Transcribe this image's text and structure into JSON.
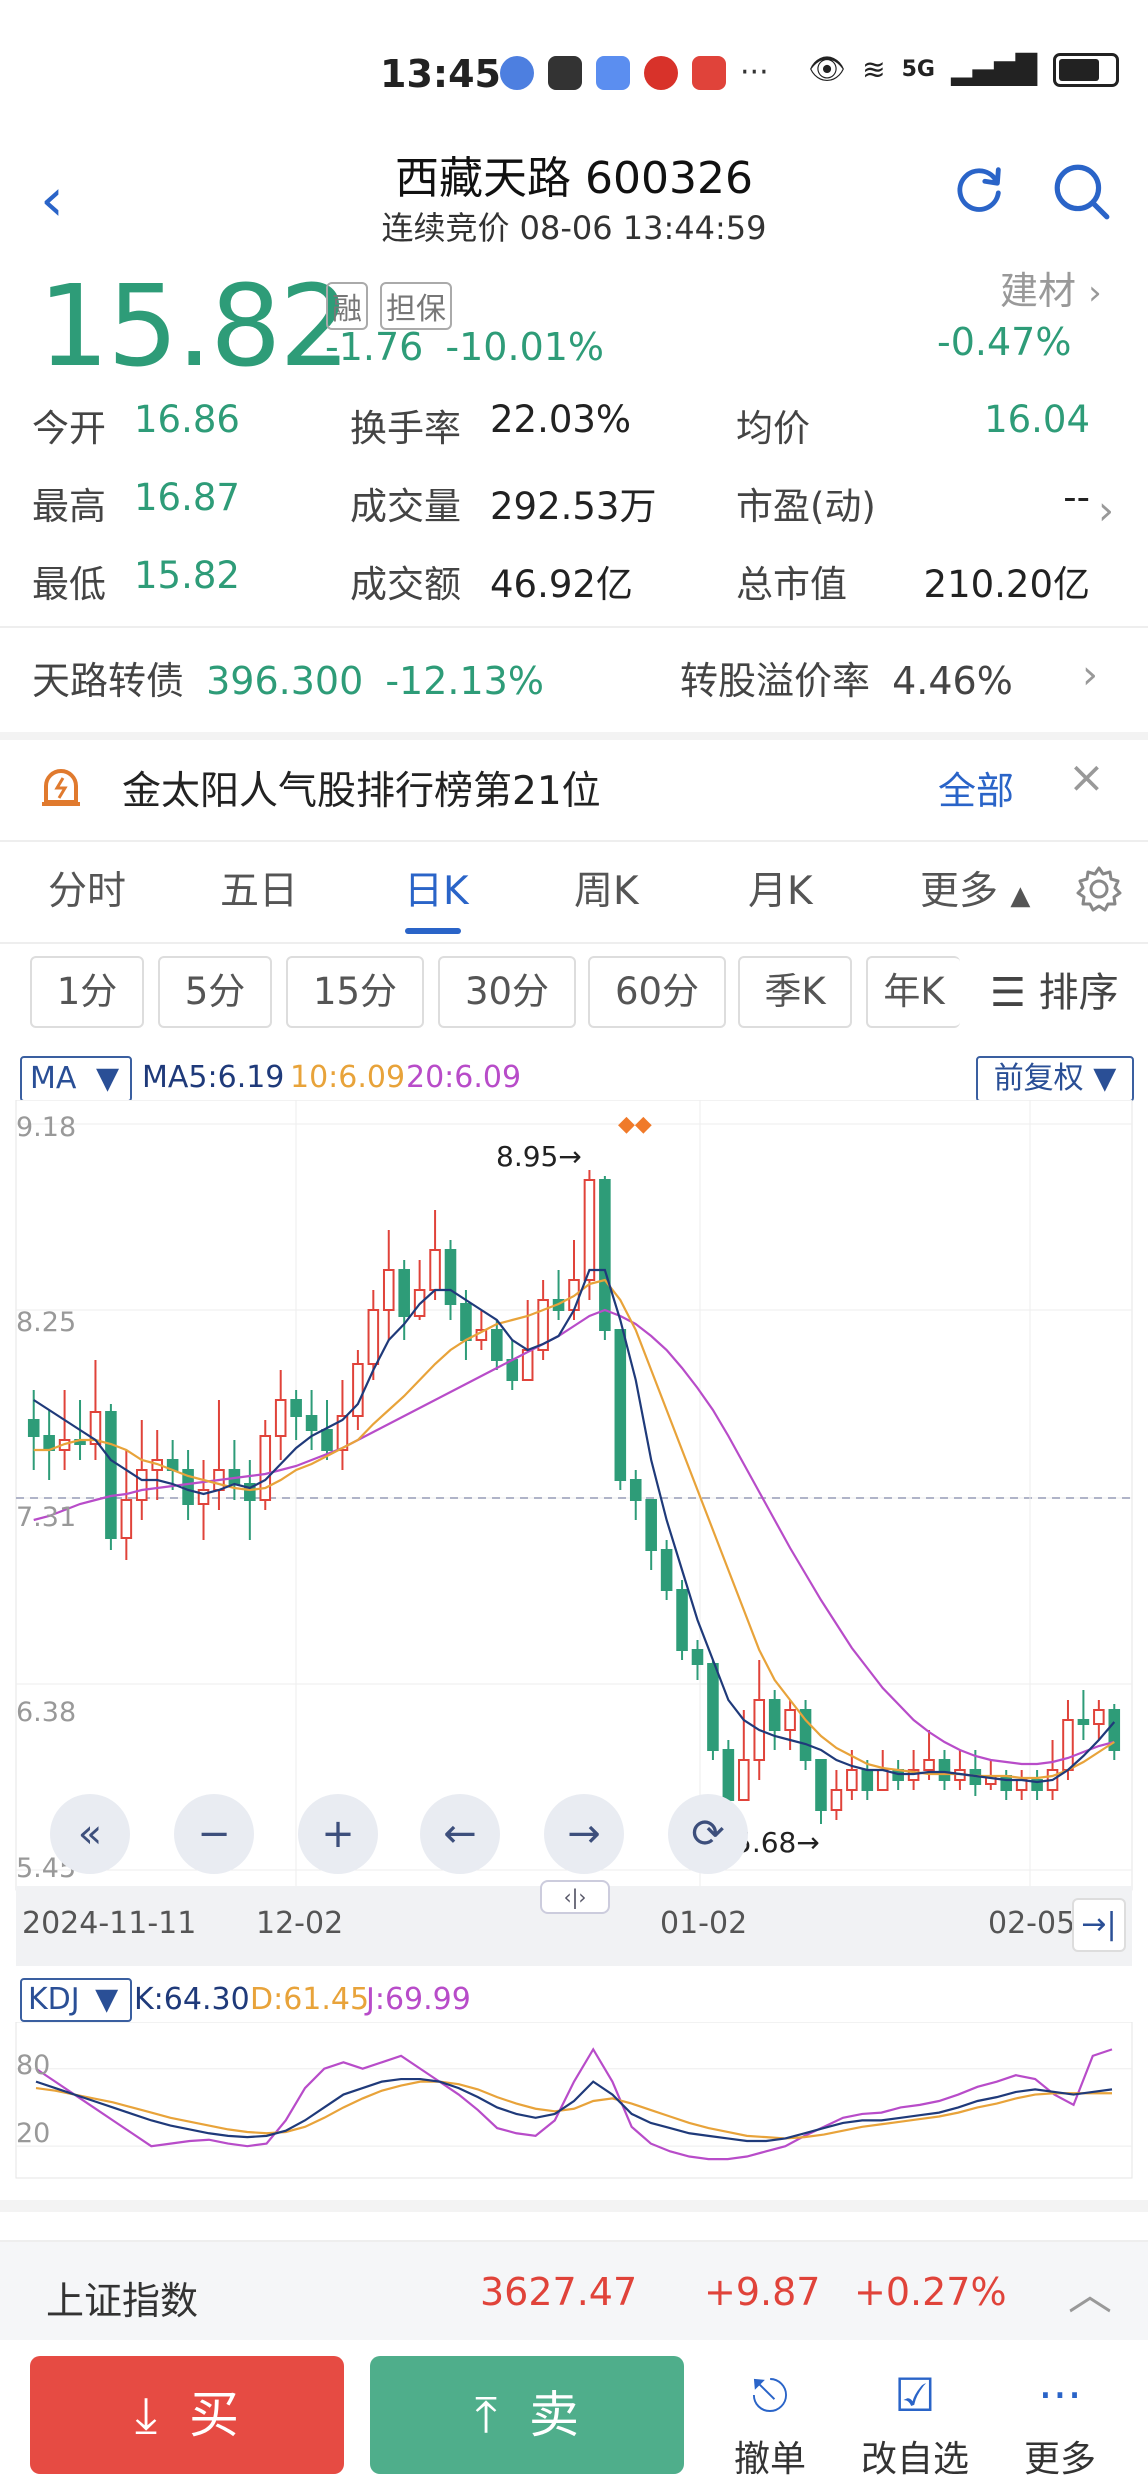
{
  "status_bar": {
    "time": "13:45",
    "net": "5G"
  },
  "header": {
    "title": "西藏天路 600326",
    "subtitle": "连续竞价 08-06 13:44:59"
  },
  "quote": {
    "price": "15.82",
    "tag_margin": "融",
    "tag_guarantee": "担保",
    "change": "-1.76",
    "change_pct": "-10.01%",
    "sector": "建材",
    "sector_change": "-0.47%"
  },
  "stats": [
    {
      "label": "今开",
      "value": "16.86",
      "color": "#2e9c78"
    },
    {
      "label": "换手率",
      "value": "22.03%",
      "color": "#222222"
    },
    {
      "label": "均价",
      "value": "16.04",
      "color": "#2e9c78"
    },
    {
      "label": "最高",
      "value": "16.87",
      "color": "#2e9c78"
    },
    {
      "label": "成交量",
      "value": "292.53万",
      "color": "#222222"
    },
    {
      "label": "市盈(动)",
      "value": "--",
      "color": "#222222"
    },
    {
      "label": "最低",
      "value": "15.82",
      "color": "#2e9c78"
    },
    {
      "label": "成交额",
      "value": "46.92亿",
      "color": "#222222"
    },
    {
      "label": "总市值",
      "value": "210.20亿",
      "color": "#222222"
    }
  ],
  "bond": {
    "name": "天路转债",
    "price": "396.300",
    "change": "-12.13%",
    "premium_label": "转股溢价率",
    "premium": "4.46%"
  },
  "promo": {
    "text": "金太阳人气股排行榜第21位",
    "action": "全部"
  },
  "tabs": [
    "分时",
    "五日",
    "日K",
    "周K",
    "月K",
    "更多"
  ],
  "periods": [
    "1分",
    "5分",
    "15分",
    "30分",
    "60分",
    "季K",
    "年K"
  ],
  "sort_label": "排序",
  "chart": {
    "ma_btn": "MA",
    "ma5": "MA5:6.19",
    "ma10": "10:6.09",
    "ma20": "20:6.09",
    "adjust": "前复权",
    "yticks": [
      "9.18",
      "8.25",
      "7.31",
      "6.38",
      "5.45"
    ],
    "xticks": [
      "2024-11-11",
      "12-02",
      "01-02",
      "02-05"
    ],
    "high_label": "8.95→",
    "low_label": "5.68→",
    "kdj_btn": "KDJ",
    "k": "K:64.30",
    "d": "D:61.45",
    "j": "J:69.99",
    "kdj_ticks": [
      "80",
      "20"
    ]
  },
  "chart_data": {
    "type": "candlestick",
    "ylim": [
      5.45,
      9.18
    ],
    "yticks": [
      "9.18",
      "8.25",
      "7.31",
      "6.38",
      "5.45"
    ],
    "xticks": [
      "2024-11-11",
      "12-02",
      "01-02",
      "02-05"
    ],
    "series_colors": {
      "up": "#e0433a",
      "down": "#2e9c78",
      "ma5": "#1f3a7a",
      "ma10": "#e8a33a",
      "ma20": "#b84cc9",
      "kdj_k": "#1f3a7a",
      "kdj_d": "#e8a33a",
      "kdj_j": "#b84cc9"
    },
    "candles": [
      [
        7.7,
        7.62,
        7.85,
        7.45
      ],
      [
        7.62,
        7.55,
        7.75,
        7.4
      ],
      [
        7.55,
        7.6,
        7.85,
        7.45
      ],
      [
        7.6,
        7.58,
        7.8,
        7.5
      ],
      [
        7.58,
        7.74,
        8.0,
        7.5
      ],
      [
        7.74,
        7.11,
        7.78,
        7.05
      ],
      [
        7.11,
        7.3,
        7.55,
        7.0
      ],
      [
        7.3,
        7.45,
        7.7,
        7.2
      ],
      [
        7.45,
        7.5,
        7.65,
        7.3
      ],
      [
        7.5,
        7.45,
        7.6,
        7.35
      ],
      [
        7.45,
        7.28,
        7.55,
        7.2
      ],
      [
        7.28,
        7.35,
        7.5,
        7.1
      ],
      [
        7.35,
        7.45,
        7.8,
        7.25
      ],
      [
        7.45,
        7.38,
        7.6,
        7.3
      ],
      [
        7.38,
        7.3,
        7.5,
        7.1
      ],
      [
        7.3,
        7.62,
        7.7,
        7.25
      ],
      [
        7.62,
        7.8,
        7.95,
        7.5
      ],
      [
        7.8,
        7.72,
        7.85,
        7.6
      ],
      [
        7.72,
        7.65,
        7.85,
        7.55
      ],
      [
        7.65,
        7.55,
        7.8,
        7.5
      ],
      [
        7.55,
        7.72,
        7.9,
        7.45
      ],
      [
        7.72,
        7.98,
        8.05,
        7.65
      ],
      [
        7.98,
        8.25,
        8.35,
        7.9
      ],
      [
        8.25,
        8.45,
        8.65,
        8.1
      ],
      [
        8.45,
        8.22,
        8.5,
        8.1
      ],
      [
        8.22,
        8.35,
        8.5,
        8.2
      ],
      [
        8.35,
        8.55,
        8.75,
        8.3
      ],
      [
        8.55,
        8.28,
        8.6,
        8.2
      ],
      [
        8.28,
        8.1,
        8.35,
        8.0
      ],
      [
        8.1,
        8.15,
        8.25,
        8.05
      ],
      [
        8.15,
        8.0,
        8.2,
        7.95
      ],
      [
        8.0,
        7.9,
        8.1,
        7.85
      ],
      [
        7.9,
        8.05,
        8.3,
        7.9
      ],
      [
        8.05,
        8.3,
        8.4,
        8.0
      ],
      [
        8.3,
        8.25,
        8.45,
        8.2
      ],
      [
        8.25,
        8.4,
        8.6,
        8.2
      ],
      [
        8.4,
        8.9,
        8.95,
        8.3
      ],
      [
        8.9,
        8.15,
        8.92,
        8.1
      ],
      [
        8.15,
        7.4,
        7.55,
        7.35
      ],
      [
        7.4,
        7.3,
        7.45,
        7.2
      ],
      [
        7.3,
        7.05,
        7.25,
        6.95
      ],
      [
        7.05,
        6.85,
        7.1,
        6.8
      ],
      [
        6.85,
        6.55,
        6.9,
        6.5
      ],
      [
        6.55,
        6.48,
        6.6,
        6.4
      ],
      [
        6.48,
        6.05,
        6.5,
        6.0
      ],
      [
        6.05,
        5.8,
        6.1,
        5.75
      ],
      [
        5.8,
        6.0,
        6.25,
        5.8
      ],
      [
        6.0,
        6.3,
        6.5,
        5.9
      ],
      [
        6.3,
        6.15,
        6.35,
        6.05
      ],
      [
        6.15,
        6.25,
        6.3,
        6.05
      ],
      [
        6.25,
        6.0,
        6.3,
        5.95
      ],
      [
        6.0,
        5.75,
        6.0,
        5.68
      ],
      [
        5.75,
        5.85,
        5.95,
        5.7
      ],
      [
        5.85,
        5.95,
        6.05,
        5.8
      ],
      [
        5.95,
        5.85,
        6.0,
        5.8
      ],
      [
        5.85,
        5.95,
        6.05,
        5.85
      ],
      [
        5.95,
        5.9,
        6.0,
        5.85
      ],
      [
        5.9,
        5.95,
        6.05,
        5.85
      ],
      [
        5.95,
        6.0,
        6.15,
        5.9
      ],
      [
        6.0,
        5.9,
        6.05,
        5.85
      ],
      [
        5.9,
        5.95,
        6.05,
        5.85
      ],
      [
        5.95,
        5.88,
        6.05,
        5.82
      ],
      [
        5.88,
        5.92,
        6.0,
        5.85
      ],
      [
        5.92,
        5.85,
        5.95,
        5.8
      ],
      [
        5.85,
        5.9,
        5.95,
        5.8
      ],
      [
        5.9,
        5.85,
        5.95,
        5.8
      ],
      [
        5.85,
        5.95,
        6.1,
        5.8
      ],
      [
        5.95,
        6.2,
        6.3,
        5.9
      ],
      [
        6.2,
        6.18,
        6.35,
        6.1
      ],
      [
        6.18,
        6.25,
        6.3,
        6.1
      ],
      [
        6.25,
        6.05,
        6.28,
        6.0
      ]
    ],
    "ma5": [
      7.8,
      7.75,
      7.7,
      7.65,
      7.6,
      7.5,
      7.45,
      7.4,
      7.4,
      7.38,
      7.35,
      7.33,
      7.35,
      7.38,
      7.36,
      7.4,
      7.48,
      7.56,
      7.62,
      7.66,
      7.7,
      7.78,
      7.95,
      8.1,
      8.18,
      8.28,
      8.35,
      8.35,
      8.3,
      8.25,
      8.2,
      8.1,
      8.05,
      8.08,
      8.12,
      8.25,
      8.45,
      8.45,
      8.2,
      7.9,
      7.5,
      7.2,
      6.95,
      6.7,
      6.5,
      6.3,
      6.2,
      6.15,
      6.12,
      6.1,
      6.08,
      6.05,
      6.0,
      5.97,
      5.95,
      5.95,
      5.93,
      5.93,
      5.94,
      5.94,
      5.93,
      5.92,
      5.91,
      5.9,
      5.9,
      5.89,
      5.9,
      5.95,
      6.02,
      6.1,
      6.19
    ],
    "ma10": [
      7.55,
      7.55,
      7.58,
      7.6,
      7.6,
      7.58,
      7.55,
      7.5,
      7.48,
      7.45,
      7.42,
      7.4,
      7.38,
      7.36,
      7.35,
      7.36,
      7.4,
      7.45,
      7.48,
      7.52,
      7.56,
      7.6,
      7.68,
      7.75,
      7.82,
      7.9,
      7.98,
      8.05,
      8.1,
      8.14,
      8.18,
      8.2,
      8.22,
      8.25,
      8.28,
      8.32,
      8.38,
      8.4,
      8.3,
      8.15,
      7.95,
      7.75,
      7.55,
      7.35,
      7.15,
      6.95,
      6.75,
      6.55,
      6.4,
      6.3,
      6.2,
      6.12,
      6.06,
      6.02,
      5.98,
      5.96,
      5.95,
      5.94,
      5.93,
      5.93,
      5.93,
      5.92,
      5.92,
      5.92,
      5.91,
      5.91,
      5.92,
      5.95,
      5.99,
      6.04,
      6.09
    ],
    "ma20": [
      7.2,
      7.22,
      7.25,
      7.28,
      7.3,
      7.32,
      7.33,
      7.35,
      7.36,
      7.37,
      7.38,
      7.39,
      7.4,
      7.41,
      7.42,
      7.43,
      7.45,
      7.47,
      7.5,
      7.53,
      7.56,
      7.6,
      7.64,
      7.68,
      7.72,
      7.76,
      7.8,
      7.84,
      7.88,
      7.92,
      7.96,
      8.0,
      8.04,
      8.08,
      8.12,
      8.17,
      8.22,
      8.25,
      8.22,
      8.18,
      8.12,
      8.05,
      7.96,
      7.86,
      7.75,
      7.62,
      7.48,
      7.34,
      7.2,
      7.06,
      6.93,
      6.8,
      6.68,
      6.56,
      6.46,
      6.36,
      6.28,
      6.2,
      6.14,
      6.09,
      6.05,
      6.02,
      6.0,
      5.99,
      5.98,
      5.98,
      5.99,
      6.01,
      6.04,
      6.07,
      6.09
    ],
    "kdj_ylim": [
      0,
      110
    ],
    "kdj_k": [
      70,
      65,
      60,
      55,
      50,
      45,
      40,
      36,
      33,
      30,
      28,
      27,
      28,
      32,
      40,
      50,
      60,
      65,
      70,
      72,
      72,
      70,
      65,
      58,
      50,
      45,
      42,
      45,
      55,
      70,
      60,
      45,
      38,
      34,
      30,
      28,
      26,
      24,
      24,
      26,
      30,
      34,
      38,
      40,
      40,
      42,
      44,
      46,
      50,
      55,
      58,
      62,
      64,
      62,
      60,
      62,
      64
    ],
    "kdj_d": [
      65,
      63,
      60,
      57,
      54,
      50,
      46,
      42,
      39,
      36,
      33,
      31,
      30,
      31,
      35,
      42,
      50,
      57,
      63,
      67,
      70,
      70,
      68,
      64,
      58,
      53,
      49,
      47,
      49,
      55,
      57,
      53,
      48,
      43,
      38,
      34,
      31,
      28,
      27,
      26,
      27,
      29,
      32,
      35,
      37,
      39,
      41,
      43,
      46,
      50,
      53,
      57,
      60,
      61,
      61,
      61,
      61
    ],
    "kdj_j": [
      80,
      70,
      60,
      50,
      40,
      30,
      20,
      22,
      24,
      25,
      22,
      20,
      22,
      40,
      65,
      80,
      85,
      80,
      85,
      90,
      80,
      70,
      60,
      48,
      34,
      30,
      28,
      40,
      70,
      95,
      70,
      35,
      22,
      16,
      12,
      10,
      10,
      12,
      16,
      20,
      28,
      35,
      42,
      45,
      46,
      50,
      52,
      55,
      60,
      66,
      70,
      75,
      72,
      60,
      52,
      90,
      95
    ]
  },
  "index": {
    "name": "上证指数",
    "value": "3627.47",
    "change": "+9.87",
    "change_pct": "+0.27%"
  },
  "bottom": {
    "buy": "买",
    "sell": "卖",
    "cancel": "撤单",
    "watch": "改自选",
    "more": "更多"
  }
}
